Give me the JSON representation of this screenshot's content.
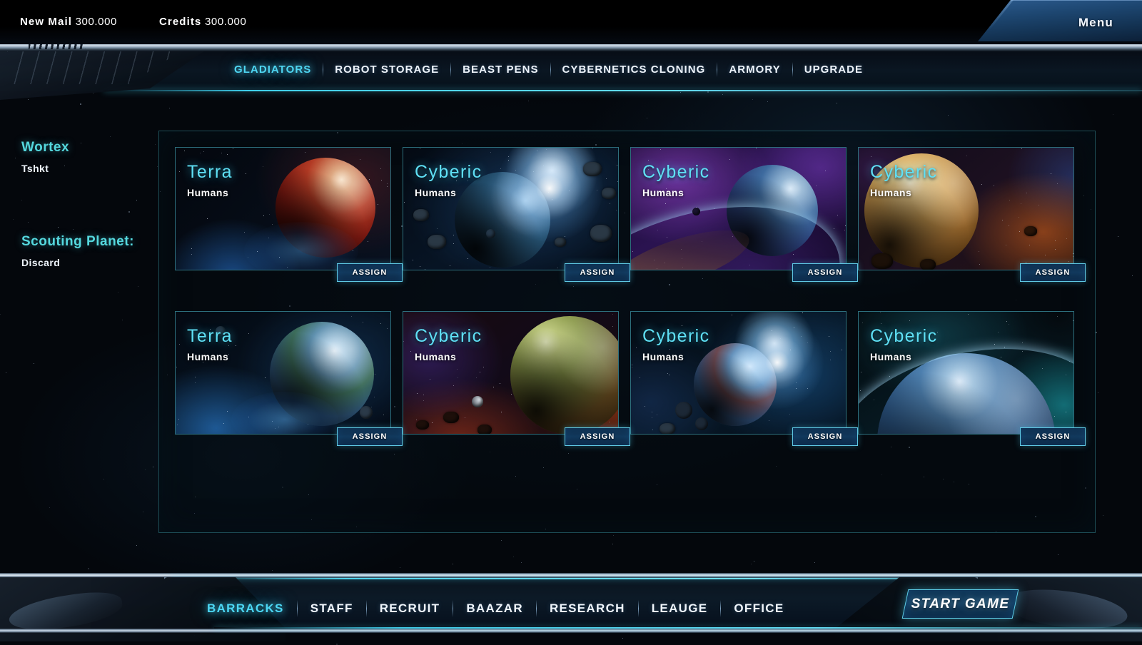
{
  "topbar": {
    "mail_label": "New Mail",
    "mail_value": "300.000",
    "credits_label": "Credits",
    "credits_value": "300.000",
    "menu_label": "Menu"
  },
  "main_nav": {
    "items": [
      {
        "label": "GLADIATORS",
        "active": true
      },
      {
        "label": "ROBOT STORAGE",
        "active": false
      },
      {
        "label": "BEAST PENS",
        "active": false
      },
      {
        "label": "CYBERNETICS CLONING",
        "active": false
      },
      {
        "label": "ARMORY",
        "active": false
      },
      {
        "label": "UPGRADE",
        "active": false
      }
    ]
  },
  "sidebar": {
    "blocks": [
      {
        "title": "Wortex",
        "value": "Tshkt"
      },
      {
        "title": "Scouting Planet:",
        "value": "Discard"
      }
    ]
  },
  "planets": {
    "assign_label": "ASSIGN",
    "cards": [
      {
        "title": "Terra",
        "race": "Humans",
        "theme": "red-nebula"
      },
      {
        "title": "Cyberic",
        "race": "Humans",
        "theme": "blue-asteroid"
      },
      {
        "title": "Cyberic",
        "race": "Humans",
        "theme": "purple-ring"
      },
      {
        "title": "Cyberic",
        "race": "Humans",
        "theme": "golden-orange"
      },
      {
        "title": "Terra",
        "race": "Humans",
        "theme": "earth-blue"
      },
      {
        "title": "Cyberic",
        "race": "Humans",
        "theme": "green-ember"
      },
      {
        "title": "Cyberic",
        "race": "Humans",
        "theme": "blue-flare"
      },
      {
        "title": "Cyberic",
        "race": "Humans",
        "theme": "teal-arc"
      }
    ]
  },
  "bottom_nav": {
    "items": [
      {
        "label": "BARRACKS",
        "active": true
      },
      {
        "label": "STAFF",
        "active": false
      },
      {
        "label": "RECRUIT",
        "active": false
      },
      {
        "label": "BAAZAR",
        "active": false
      },
      {
        "label": "RESEARCH",
        "active": false
      },
      {
        "label": "LEAUGE",
        "active": false
      },
      {
        "label": "OFFICE",
        "active": false
      }
    ],
    "start_button": "START GAME"
  },
  "colors": {
    "accent_cyan": "#4fd6f2",
    "title_cyan": "#5fe0f5",
    "sidebar_cyan": "#55d8de",
    "panel_border": "#1d4c55",
    "card_border": "#2d6f7d",
    "text_white": "#eef4fb",
    "bg_black": "#04070c"
  }
}
